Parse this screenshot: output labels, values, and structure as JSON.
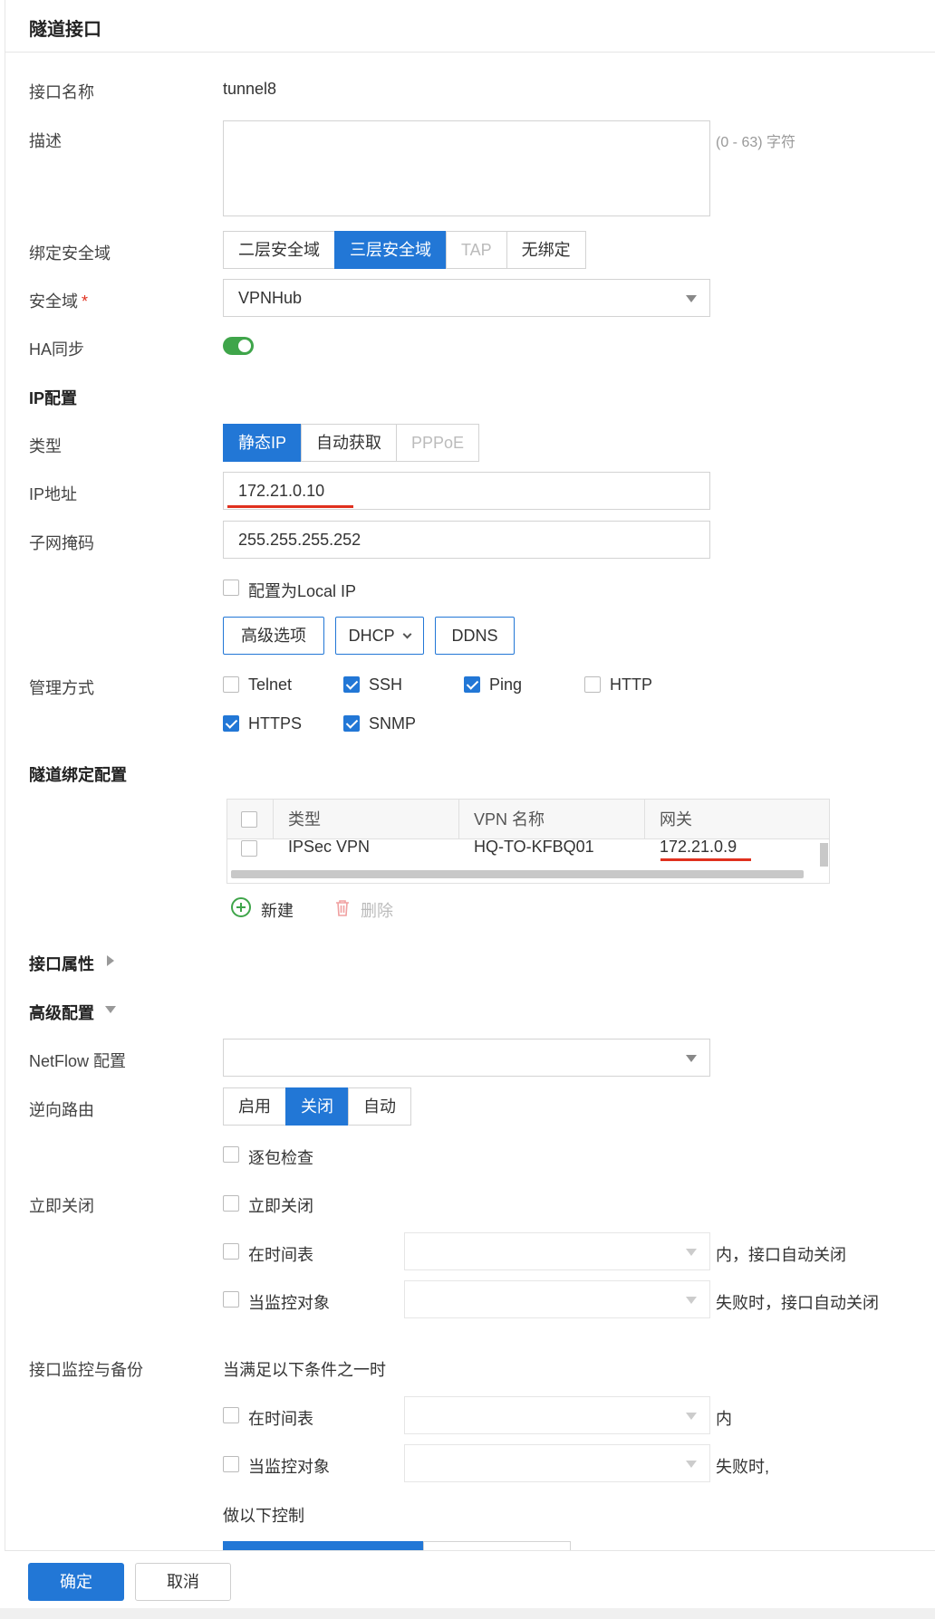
{
  "header": {
    "title": "隧道接口"
  },
  "form": {
    "name": {
      "label": "接口名称",
      "value": "tunnel8"
    },
    "desc": {
      "label": "描述",
      "hint": "(0 - 63) 字符"
    },
    "bind_zone": {
      "label": "绑定安全域",
      "options": [
        "二层安全域",
        "三层安全域",
        "TAP",
        "无绑定"
      ],
      "selected": "三层安全域"
    },
    "zone": {
      "label": "安全域",
      "required_mark": "*",
      "value": "VPNHub"
    },
    "ha": {
      "label": "HA同步",
      "on": true
    },
    "ip_section": "IP配置",
    "type": {
      "label": "类型",
      "options": [
        "静态IP",
        "自动获取",
        "PPPoE"
      ],
      "selected": "静态IP"
    },
    "ip": {
      "label": "IP地址",
      "value": "172.21.0.10"
    },
    "mask": {
      "label": "子网掩码",
      "value": "255.255.255.252"
    },
    "local_ip": {
      "label": "配置为Local IP",
      "checked": false
    },
    "buttons": {
      "advanced": "高级选项",
      "dhcp": "DHCP",
      "ddns": "DDNS"
    },
    "mgmt": {
      "label": "管理方式",
      "items": [
        {
          "label": "Telnet",
          "checked": false
        },
        {
          "label": "SSH",
          "checked": true
        },
        {
          "label": "Ping",
          "checked": true
        },
        {
          "label": "HTTP",
          "checked": false
        },
        {
          "label": "HTTPS",
          "checked": true
        },
        {
          "label": "SNMP",
          "checked": true
        }
      ]
    },
    "tunnel_section": "隧道绑定配置",
    "table": {
      "headers": [
        "类型",
        "VPN 名称",
        "网关"
      ],
      "rows": [
        {
          "type": "IPSec VPN",
          "vpn": "HQ-TO-KFBQ01",
          "gateway": "172.21.0.9"
        }
      ],
      "add": "新建",
      "delete": "删除"
    },
    "iface_attr": "接口属性",
    "adv_section": "高级配置",
    "netflow": {
      "label": "NetFlow 配置",
      "value": ""
    },
    "reverse": {
      "label": "逆向路由",
      "options": [
        "启用",
        "关闭",
        "自动"
      ],
      "selected": "关闭"
    },
    "per_packet": {
      "label": "逐包检查",
      "checked": false
    },
    "shutdown": {
      "label": "立即关闭",
      "now": "立即关闭",
      "schedule": "在时间表",
      "schedule_suffix": "内，接口自动关闭",
      "monitor": "当监控对象",
      "monitor_suffix": "失败时，接口自动关闭"
    },
    "backup": {
      "label": "接口监控与备份",
      "cond": "当满足以下条件之一时",
      "schedule": "在时间表",
      "schedule_suffix": "内",
      "monitor": "当监控对象",
      "monitor_suffix": "失败时,",
      "action": "做以下控制"
    }
  },
  "footer": {
    "ok": "确定",
    "cancel": "取消"
  },
  "colors": {
    "primary": "#2277d6",
    "toggle_on": "#3fa54a",
    "highlight": "#e0301e"
  }
}
